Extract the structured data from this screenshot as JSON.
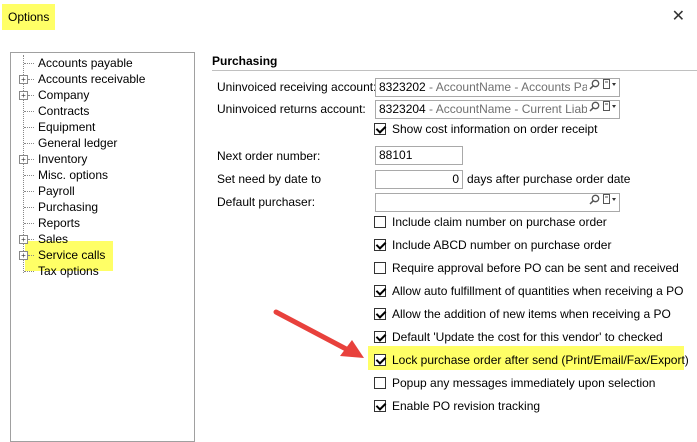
{
  "window": {
    "title": "Options",
    "close_glyph": "✕"
  },
  "tree": {
    "items": [
      {
        "label": "Accounts payable",
        "expandable": false
      },
      {
        "label": "Accounts receivable",
        "expandable": true
      },
      {
        "label": "Company",
        "expandable": true
      },
      {
        "label": "Contracts",
        "expandable": false
      },
      {
        "label": "Equipment",
        "expandable": false
      },
      {
        "label": "General ledger",
        "expandable": false
      },
      {
        "label": "Inventory",
        "expandable": true
      },
      {
        "label": "Misc. options",
        "expandable": false
      },
      {
        "label": "Payroll",
        "expandable": false
      },
      {
        "label": "Purchasing",
        "expandable": false,
        "selected": true
      },
      {
        "label": "Reports",
        "expandable": false
      },
      {
        "label": "Sales",
        "expandable": true
      },
      {
        "label": "Service calls",
        "expandable": true
      },
      {
        "label": "Tax options",
        "expandable": false
      }
    ]
  },
  "section": {
    "title": "Purchasing"
  },
  "fields": {
    "uninvoiced_receiving": {
      "label": "Uninvoiced receiving account:",
      "value_code": "8323202",
      "value_desc": " - AccountName - Accounts Payab"
    },
    "uninvoiced_returns": {
      "label": "Uninvoiced returns account:",
      "value_code": "8323204",
      "value_desc": " - AccountName - Current Liabilitie"
    },
    "next_order": {
      "label": "Next order number:",
      "value": "88101"
    },
    "set_need_by": {
      "label": "Set need by date to",
      "value": "0",
      "suffix": "days after purchase order date"
    },
    "default_purchaser": {
      "label": "Default purchaser:",
      "value": ""
    }
  },
  "checkboxes": [
    {
      "label": "Show cost information on order receipt",
      "checked": true
    },
    {
      "label": "Include claim number on purchase order",
      "checked": false
    },
    {
      "label": "Include ABCD number on purchase order",
      "checked": true
    },
    {
      "label": "Require approval before PO can be sent and received",
      "checked": false
    },
    {
      "label": "Allow auto fulfillment of quantities when receiving a PO",
      "checked": true
    },
    {
      "label": "Allow the addition of new items when receiving a PO",
      "checked": true
    },
    {
      "label": "Default 'Update the cost for this vendor' to checked",
      "checked": true
    },
    {
      "label": "Lock purchase order after send (Print/Email/Fax/Export)",
      "checked": true
    },
    {
      "label": "Popup any messages immediately upon selection",
      "checked": false
    },
    {
      "label": "Enable PO revision tracking",
      "checked": true
    }
  ],
  "colors": {
    "highlight": "#ffff66",
    "arrow": "#e8413c"
  },
  "icons": {
    "search": "search-icon",
    "dropdown": "dropdown-icon"
  }
}
